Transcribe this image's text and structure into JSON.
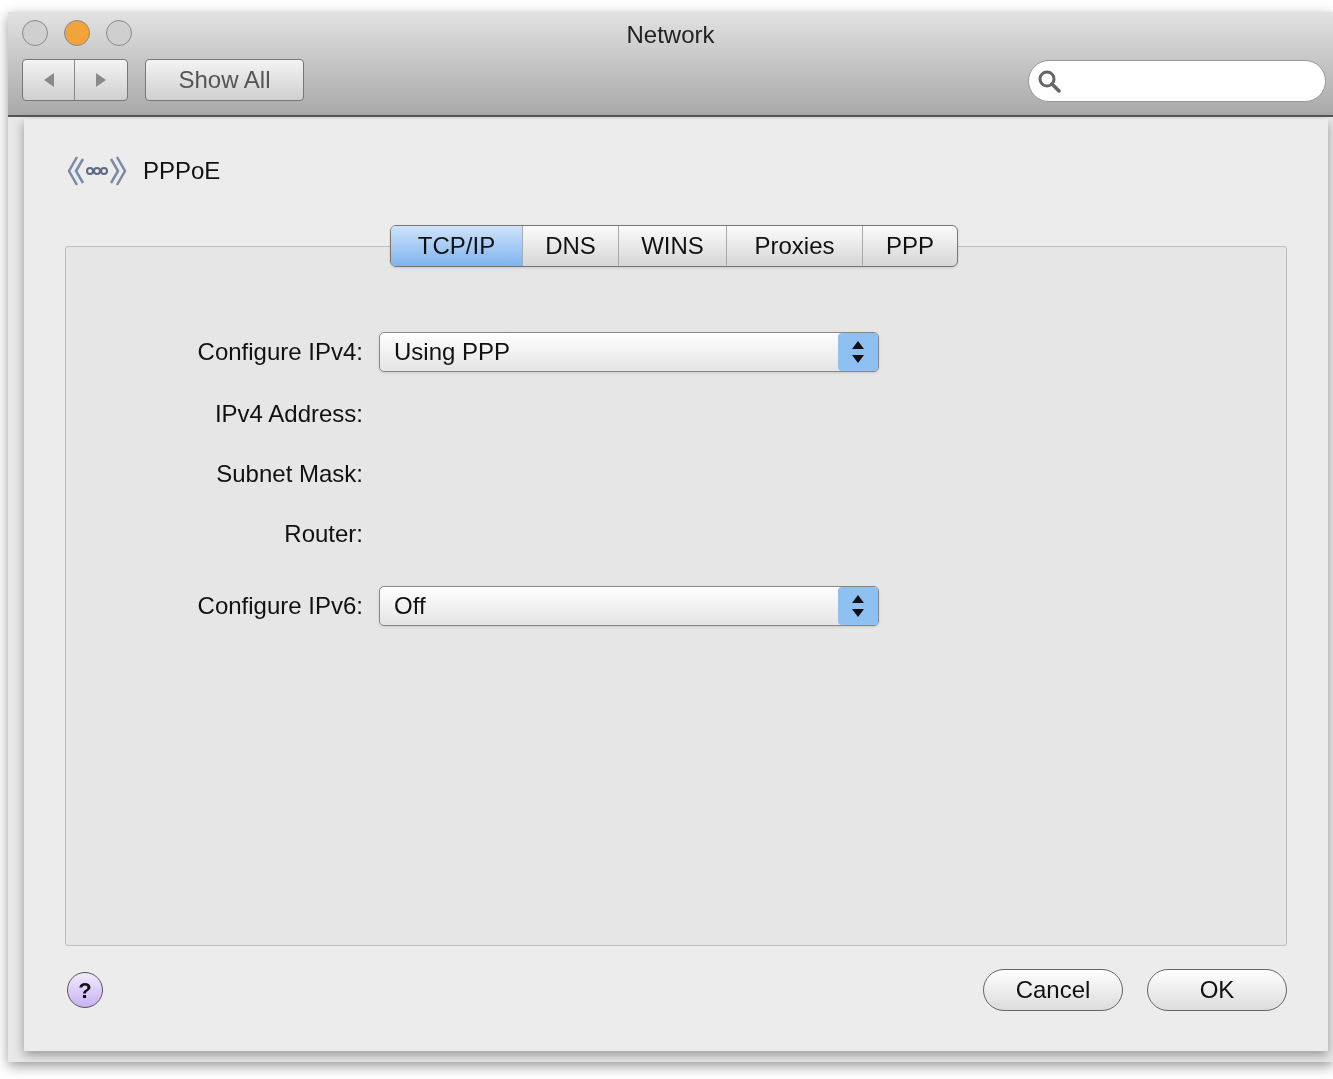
{
  "window": {
    "title": "Network",
    "traffic_lights": [
      {
        "color": "#cfcfcf"
      },
      {
        "color": "#f2a33a"
      },
      {
        "color": "#cfcfcf"
      }
    ]
  },
  "toolbar": {
    "show_all": "Show All"
  },
  "sheet": {
    "service_name": "PPPoE",
    "tabs": [
      {
        "label": "TCP/IP",
        "selected": true
      },
      {
        "label": "DNS",
        "selected": false
      },
      {
        "label": "WINS",
        "selected": false
      },
      {
        "label": "Proxies",
        "selected": false
      },
      {
        "label": "PPP",
        "selected": false
      }
    ],
    "rows": [
      {
        "kind": "popup",
        "label": "Configure IPv4:",
        "value": "Using PPP"
      },
      {
        "kind": "info",
        "label": "IPv4 Address:"
      },
      {
        "kind": "info",
        "label": "Subnet Mask:"
      },
      {
        "kind": "info",
        "label": "Router:"
      },
      {
        "kind": "popup",
        "label": "Configure IPv6:",
        "value": "Off"
      }
    ],
    "help": "?",
    "buttons": [
      "Cancel",
      "OK"
    ]
  }
}
